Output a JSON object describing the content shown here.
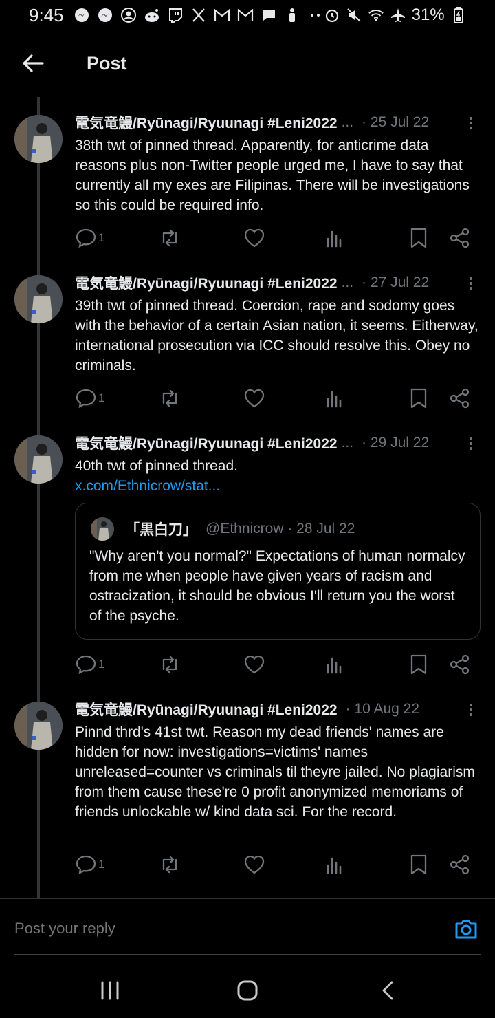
{
  "status_bar": {
    "time": "9:45",
    "battery": "31%"
  },
  "header": {
    "title": "Post"
  },
  "posts": [
    {
      "author": "電気竜鰻/Ryūnagi/Ryuunagi #Leni2022",
      "truncated": "...",
      "date": "· 25 Jul 22",
      "text": "38th twt of pinned thread. Apparently, for anticrime data reasons plus non-Twitter people urged me, I have to say that currently all my exes are Filipinas. There will be investigations so this could be required info.",
      "reply_count": "1"
    },
    {
      "author": "電気竜鰻/Ryūnagi/Ryuunagi #Leni2022",
      "truncated": "...",
      "date": "· 27 Jul 22",
      "text": "39th twt of pinned thread. Coercion, rape and sodomy goes with the behavior of a certain Asian nation, it seems. Eitherway, international prosecution via ICC should resolve this. Obey no criminals.",
      "reply_count": "1"
    },
    {
      "author": "電気竜鰻/Ryūnagi/Ryuunagi #Leni2022",
      "truncated": "...",
      "date": "· 29 Jul 22",
      "text": "40th twt of pinned thread.",
      "link": "x.com/Ethnicrow/stat...",
      "quote": {
        "name": "「黒白刀」",
        "handle": "@Ethnicrow · 28 Jul 22",
        "text": "\"Why aren't you normal?\" Expectations of human normalcy from me when people have given years of racism and ostracization, it should be obvious I'll return you the worst of the psyche."
      },
      "reply_count": "1"
    },
    {
      "author": "電気竜鰻/Ryūnagi/Ryuunagi #Leni2022",
      "date": "· 10 Aug 22",
      "text": "Pinnd thrd's 41st twt. Reason my dead friends' names are hidden for now: investigations=victims' names unreleased=counter vs criminals til theyre jailed. No plagiarism from them cause these're 0 profit anonymized memoriams of friends unlockable w/ kind data sci. For the record.",
      "reply_count": "1"
    }
  ],
  "reply": {
    "placeholder": "Post your reply"
  },
  "colors": {
    "background": "#000000",
    "text": "#e7e9ea",
    "muted": "#71767b",
    "link": "#1d9bf0",
    "divider": "#2f3336"
  }
}
